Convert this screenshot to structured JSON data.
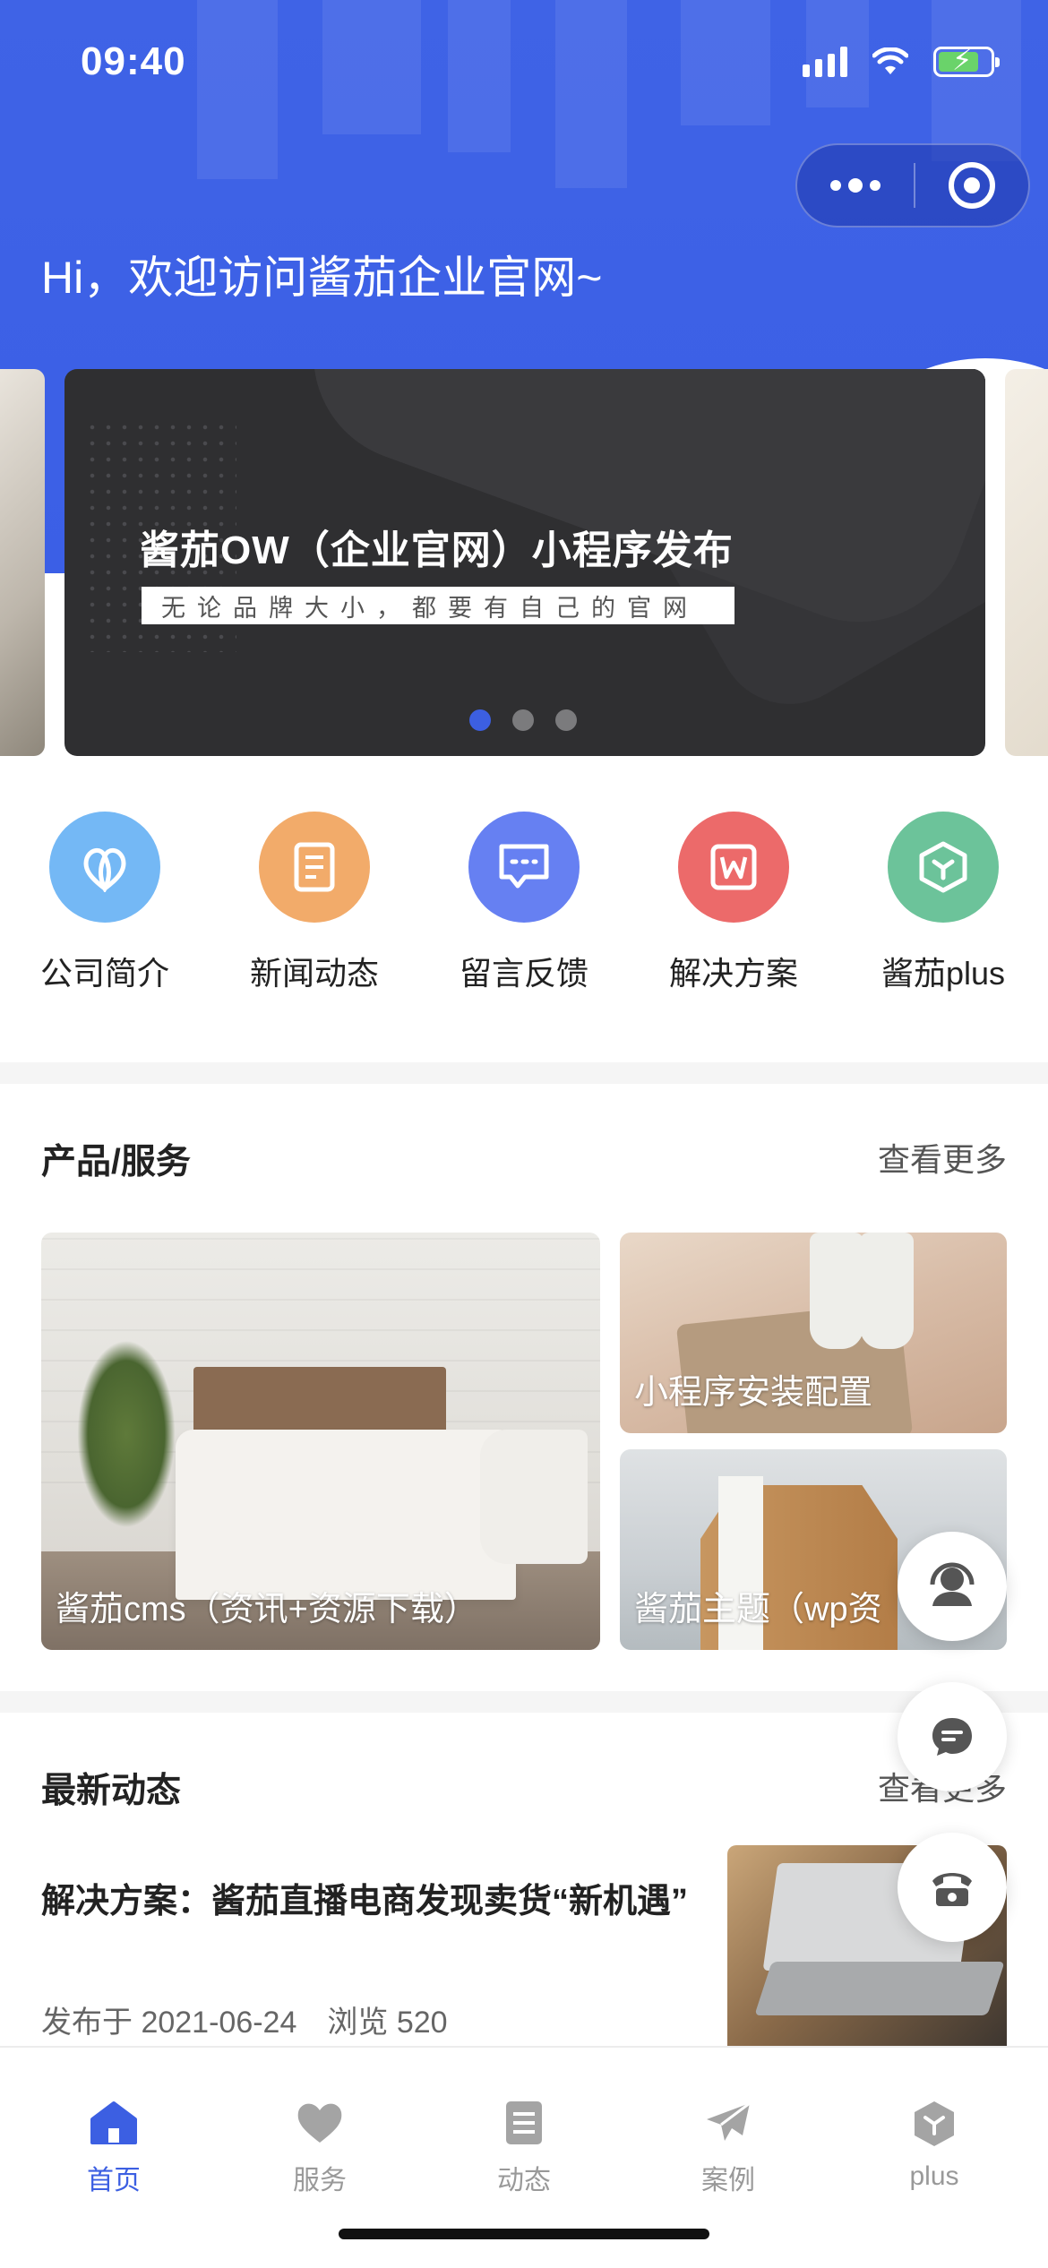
{
  "status_bar": {
    "time": "09:40"
  },
  "header": {
    "greeting": "Hi，欢迎访问酱茄企业官网~",
    "bg_color": "#3d62e6"
  },
  "banner": {
    "title": "酱茄OW（企业官网）小程序发布",
    "subtitle": "无论品牌大小，都要有自己的官网",
    "active_index": 0,
    "count": 3
  },
  "quick_nav": [
    {
      "label": "公司简介",
      "icon": "heart-outline-icon",
      "color": "#74b8f5"
    },
    {
      "label": "新闻动态",
      "icon": "document-icon",
      "color": "#f2ab6a"
    },
    {
      "label": "留言反馈",
      "icon": "message-icon",
      "color": "#6680f2"
    },
    {
      "label": "解决方案",
      "icon": "w-file-icon",
      "color": "#ec6a6a"
    },
    {
      "label": "酱茄plus",
      "icon": "cube-icon",
      "color": "#6cc39a"
    }
  ],
  "products": {
    "title": "产品/服务",
    "more": "查看更多",
    "items": [
      {
        "caption": "酱茄cms（资讯+资源下载）"
      },
      {
        "caption": "小程序安装配置"
      },
      {
        "caption": "酱茄主题（wp资"
      }
    ]
  },
  "news": {
    "title": "最新动态",
    "more": "查看更多",
    "article": {
      "title": "解决方案：酱茄直播电商发现卖货“新机遇”",
      "date": "发布于 2021-06-24",
      "views": "浏览 520"
    }
  },
  "floating": [
    {
      "icon": "customer-service-icon"
    },
    {
      "icon": "chat-icon"
    },
    {
      "icon": "phone-icon"
    }
  ],
  "tabbar": [
    {
      "label": "首页",
      "icon": "home-icon",
      "active": true
    },
    {
      "label": "服务",
      "icon": "heart-icon",
      "active": false
    },
    {
      "label": "动态",
      "icon": "list-icon",
      "active": false
    },
    {
      "label": "案例",
      "icon": "send-icon",
      "active": false
    },
    {
      "label": "plus",
      "icon": "cube-icon",
      "active": false
    }
  ],
  "accent_color": "#3c5fe2"
}
